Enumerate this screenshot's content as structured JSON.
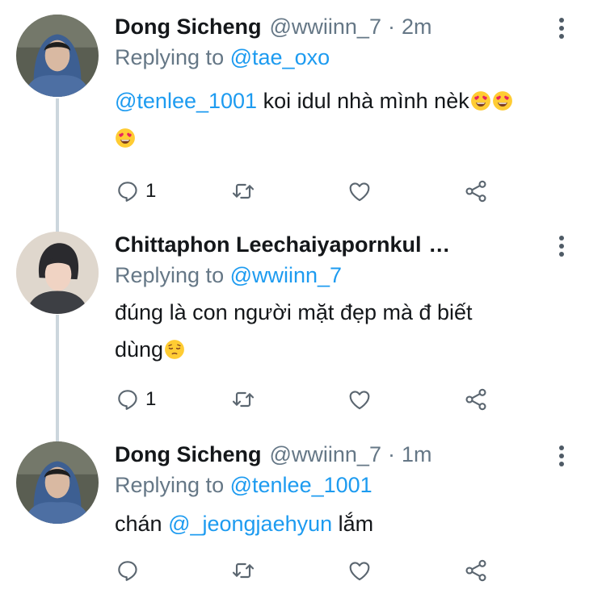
{
  "tweets": [
    {
      "name": "Dong Sicheng",
      "handle": "@wwiinn_7",
      "separator": "·",
      "time": "2m",
      "reply_prefix": "Replying to",
      "reply_to": "@tae_oxo",
      "text_mention": "@tenlee_1001",
      "text_line1": " koi idul nhà mình nèk",
      "emojis": [
        "heart-eyes-emoji",
        "heart-eyes-emoji",
        "heart-eyes-emoji"
      ],
      "reply_count": "1"
    },
    {
      "name": "Chittaphon Leechaiyapornkul",
      "name_ellipsis": "...",
      "reply_prefix": "Replying to",
      "reply_to": "@wwiinn_7",
      "text_line1": "đúng là con người mặt đẹp mà đ biết",
      "text_line2": "dùng",
      "emojis": [
        "pensive-emoji"
      ],
      "reply_count": "1"
    },
    {
      "name": "Dong Sicheng",
      "handle": "@wwiinn_7",
      "separator": "·",
      "time": "1m",
      "reply_prefix": "Replying to",
      "reply_to": "@tenlee_1001",
      "text_pre": "chán ",
      "text_mention": "@_jeongjaehyun",
      "text_post": " lắm",
      "reply_count": ""
    }
  ],
  "colors": {
    "mention": "#1d9bf0",
    "secondary_text": "#657786",
    "thread_line": "#ccd6dd",
    "icon": "#5b6670"
  },
  "icons": [
    "reply-icon",
    "retweet-icon",
    "like-icon",
    "share-icon",
    "more-vertical-icon"
  ]
}
